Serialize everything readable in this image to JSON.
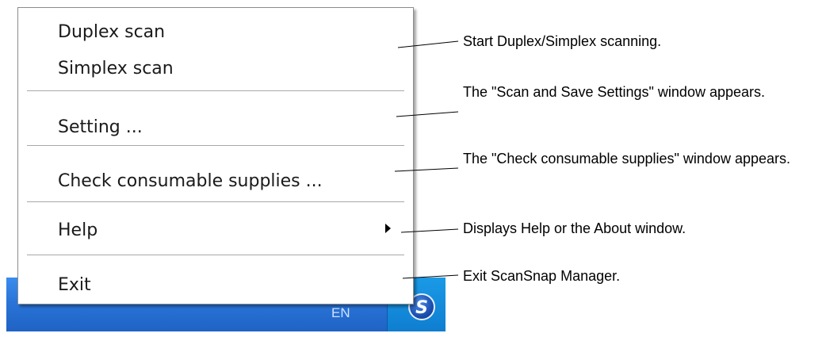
{
  "menu": {
    "items": [
      {
        "label": "Duplex scan"
      },
      {
        "label": "Simplex scan"
      },
      {
        "label": "Setting ..."
      },
      {
        "label": "Check consumable supplies ..."
      },
      {
        "label": "Help"
      },
      {
        "label": "Exit"
      }
    ]
  },
  "taskbar": {
    "language": "EN"
  },
  "callouts": [
    {
      "text": "Start Duplex/Simplex scanning."
    },
    {
      "text": "The \"Scan and Save Settings\" window appears."
    },
    {
      "text": "The \"Check consumable supplies\" window appears."
    },
    {
      "text": "Displays Help or the About window."
    },
    {
      "text": "Exit ScanSnap Manager."
    }
  ],
  "icons": {
    "tray": "scansnap-manager-icon",
    "submenu": "submenu-arrow-icon"
  },
  "colors": {
    "taskbar": "#2a74d8",
    "tray": "#0f7ed0"
  }
}
